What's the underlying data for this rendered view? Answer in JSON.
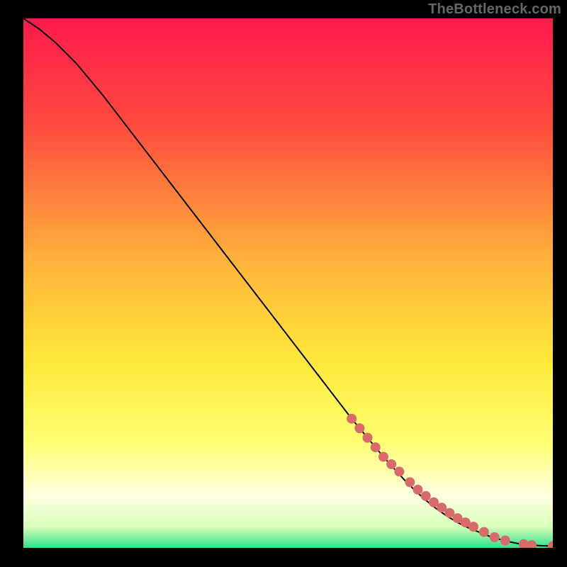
{
  "watermark": "TheBottleneck.com",
  "colors": {
    "gradient_top": "#ff1a4b",
    "gradient_mid_upper": "#ff6a3a",
    "gradient_mid": "#ffd23a",
    "gradient_mid_lower": "#ffff70",
    "gradient_pale": "#ffffe0",
    "gradient_green": "#2fe08f",
    "line": "#000000",
    "point_fill": "#d86a6a",
    "point_stroke": "#b94a4a"
  },
  "chart_data": {
    "type": "line",
    "title": "",
    "xlabel": "",
    "ylabel": "",
    "xlim": [
      0,
      100
    ],
    "ylim": [
      0,
      100
    ],
    "series": [
      {
        "name": "curve",
        "x": [
          0,
          3,
          6,
          10,
          15,
          20,
          25,
          30,
          35,
          40,
          45,
          50,
          55,
          60,
          62,
          64,
          66,
          68,
          70,
          72,
          74,
          76,
          78,
          80,
          82,
          84,
          86,
          88,
          90,
          92,
          94,
          96,
          98,
          100
        ],
        "y": [
          100,
          98,
          95.5,
          91.5,
          85.5,
          79,
          72.5,
          66,
          59.5,
          53,
          46.5,
          40,
          33.5,
          27,
          24.4,
          22,
          19.6,
          17.2,
          15,
          12.8,
          10.8,
          9,
          7.4,
          6,
          4.8,
          3.8,
          3,
          2.2,
          1.6,
          1.1,
          0.7,
          0.5,
          0.4,
          0.35
        ]
      },
      {
        "name": "points",
        "x": [
          62,
          63.5,
          65,
          66.5,
          68,
          69.5,
          71,
          73,
          74.5,
          76,
          77.5,
          79,
          80.5,
          82,
          83.5,
          85,
          87,
          89,
          91,
          94.5,
          96,
          100
        ],
        "y": [
          24.4,
          22.6,
          20.8,
          19.0,
          17.2,
          15.8,
          14.4,
          12.4,
          11.0,
          9.8,
          8.6,
          7.6,
          6.6,
          5.6,
          4.8,
          4.0,
          3.0,
          2.0,
          1.4,
          0.7,
          0.5,
          0.35
        ]
      }
    ],
    "gradient_bands_y_pct": [
      {
        "y": 0,
        "color": "#ff1a4b"
      },
      {
        "y": 20,
        "color": "#ff4a3e"
      },
      {
        "y": 45,
        "color": "#ffb03a"
      },
      {
        "y": 65,
        "color": "#ffe93a"
      },
      {
        "y": 80,
        "color": "#ffff70"
      },
      {
        "y": 90,
        "color": "#ffffe0"
      },
      {
        "y": 96,
        "color": "#d8ffb8"
      },
      {
        "y": 100,
        "color": "#2fe08f"
      }
    ]
  }
}
